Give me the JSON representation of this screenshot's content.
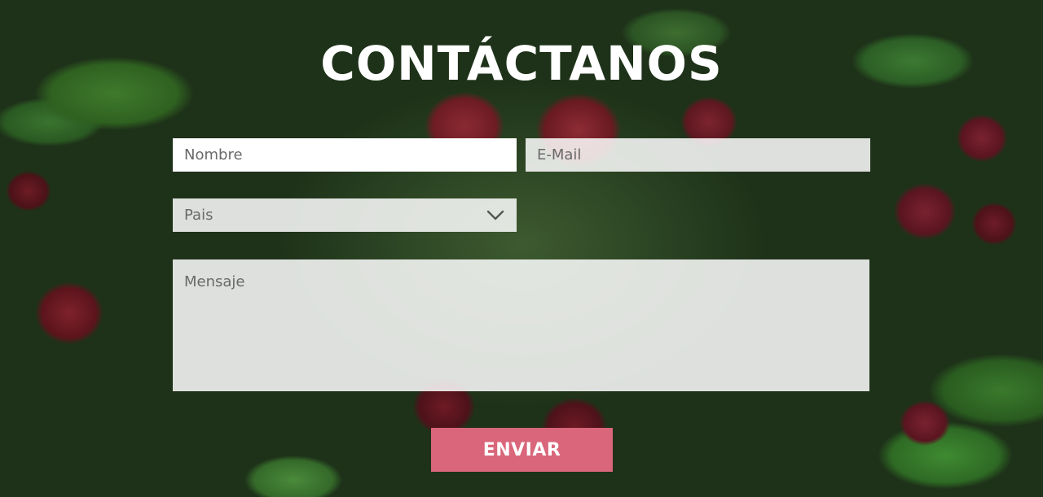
{
  "contact": {
    "title": "CONTÁCTANOS",
    "fields": {
      "name_placeholder": "Nombre",
      "email_placeholder": "E-Mail",
      "country_selected": "Pais",
      "message_placeholder": "Mensaje"
    },
    "submit_label": "ENVIAR"
  },
  "colors": {
    "button": "#d9667a",
    "title": "#ffffff"
  },
  "icons": {
    "select_chevron": "chevron-down-icon"
  }
}
